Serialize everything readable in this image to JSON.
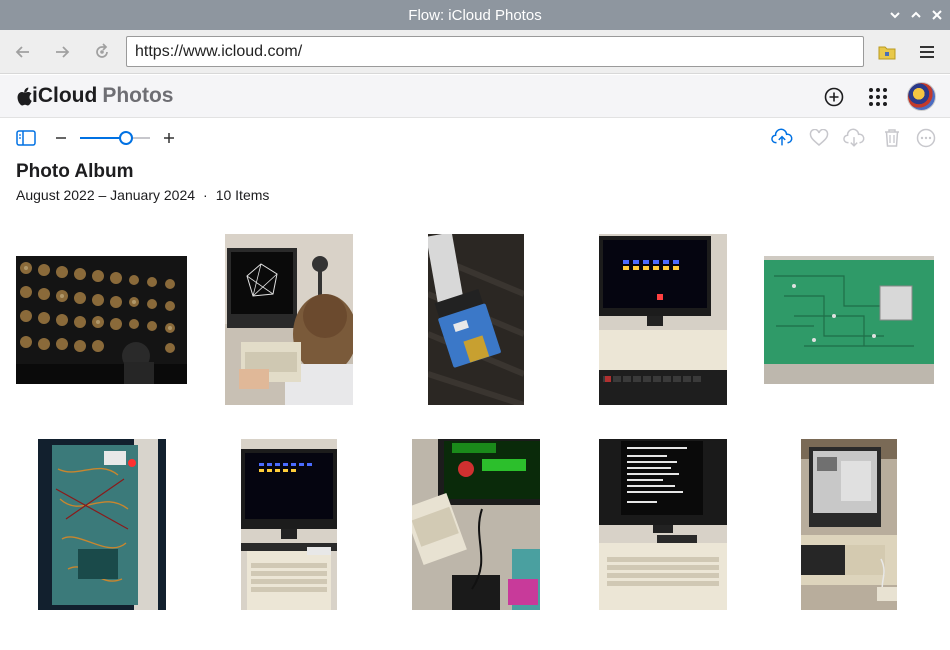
{
  "window": {
    "title": "Flow: iCloud Photos"
  },
  "browser": {
    "url": "https://www.icloud.com/"
  },
  "app": {
    "brand_left": "iCloud",
    "brand_right": "Photos"
  },
  "album": {
    "title": "Photo Album",
    "date_range": "August 2022 – January 2024",
    "separator": "·",
    "count": "10 Items"
  },
  "icons": {
    "back": "back-arrow-icon",
    "forward": "forward-arrow-icon",
    "reload": "reload-icon",
    "folder": "folder-icon",
    "menu": "hamburger-menu-icon",
    "add": "plus-circle-icon",
    "apps": "app-grid-icon",
    "sidebar": "sidebar-toggle-icon",
    "zoom_out": "minus-icon",
    "zoom_in": "plus-icon",
    "upload": "cloud-upload-icon",
    "favorite": "heart-icon",
    "download": "cloud-download-icon",
    "delete": "trash-icon",
    "more": "ellipsis-circle-icon"
  },
  "zoom": {
    "level": 0.65
  },
  "colors": {
    "accent": "#0071e3",
    "titlebar": "#8e969f"
  },
  "photos": [
    {
      "name": "photo-vinyl-wall-display"
    },
    {
      "name": "photo-child-at-retro-computer"
    },
    {
      "name": "photo-sd-card-adapter-ribbon"
    },
    {
      "name": "photo-space-invaders-monitor"
    },
    {
      "name": "photo-green-circuit-board"
    },
    {
      "name": "photo-wired-prototype-board"
    },
    {
      "name": "photo-invaders-game-on-monitor"
    },
    {
      "name": "photo-repton-game-setup"
    },
    {
      "name": "photo-text-screen-retro-pc"
    },
    {
      "name": "photo-desk-retro-computer"
    }
  ]
}
